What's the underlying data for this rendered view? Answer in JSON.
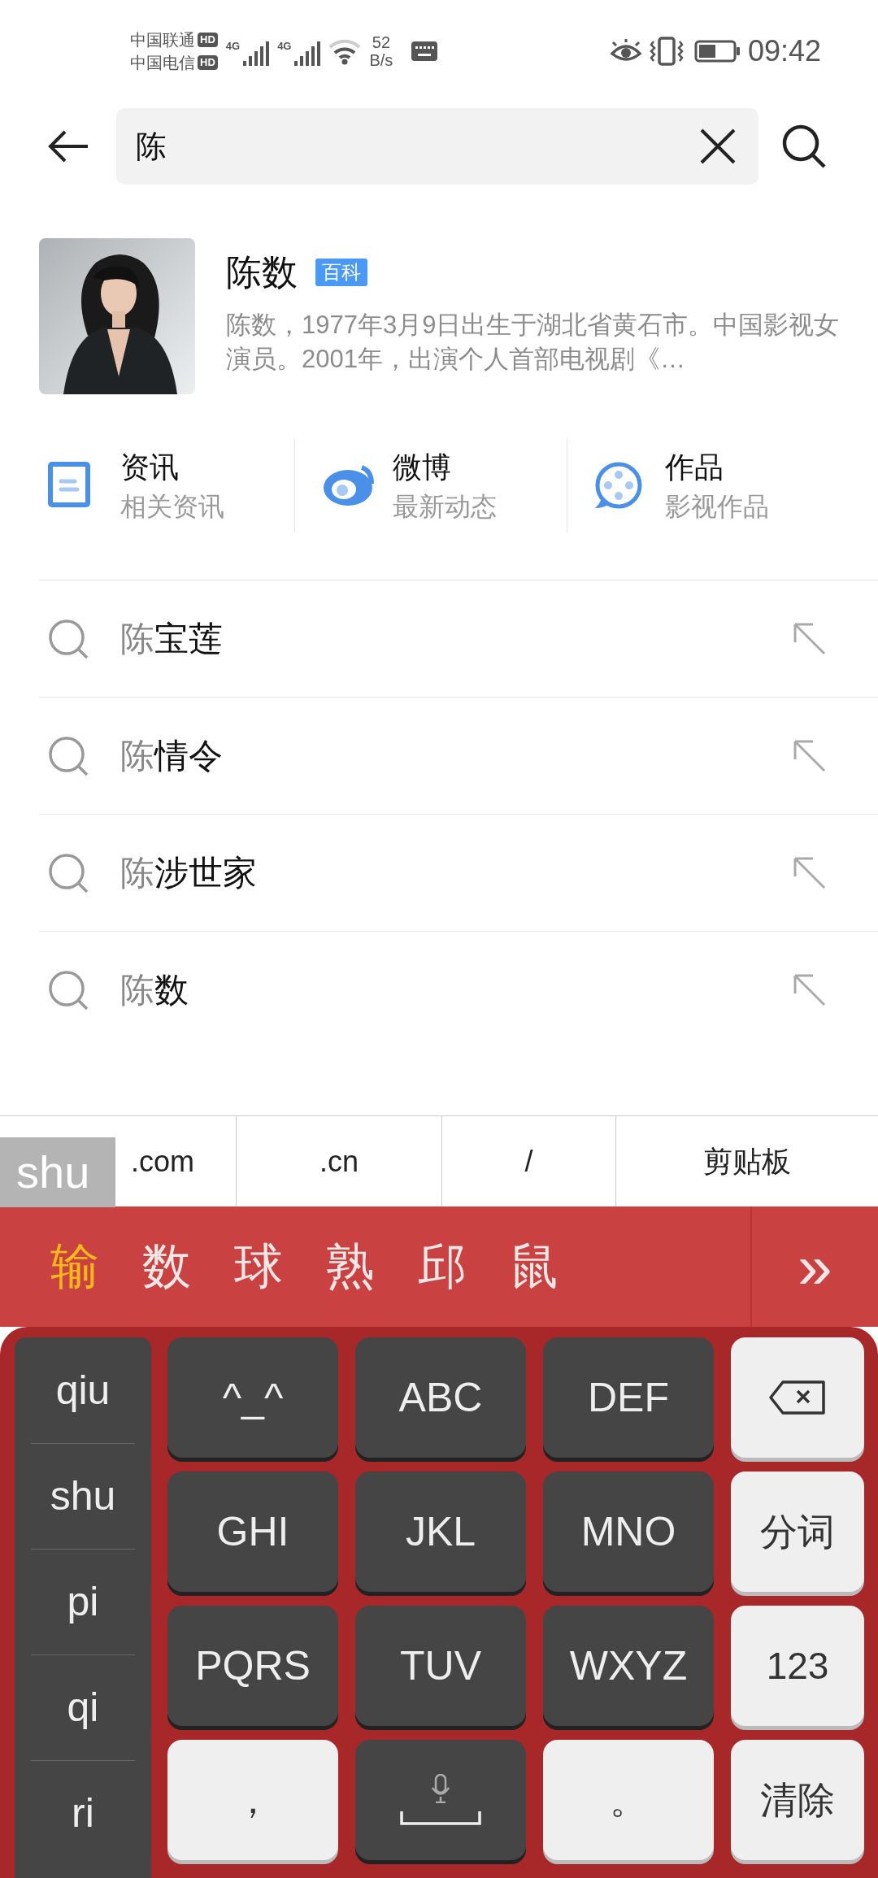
{
  "status_bar": {
    "carriers": [
      {
        "name": "中国联通",
        "badge": "HD"
      },
      {
        "name": "中国电信",
        "badge": "HD"
      }
    ],
    "network_types": [
      "4G",
      "4G"
    ],
    "speed_value": "52",
    "speed_unit": "B/s",
    "time": "09:42"
  },
  "search": {
    "value": "陈"
  },
  "result_card": {
    "title": "陈数",
    "badge": "百科",
    "description": "陈数，1977年3月9日出生于湖北省黄石市。中国影视女演员。2001年，出演个人首部电视剧《…"
  },
  "shortcuts": [
    {
      "kind": "news",
      "title": "资讯",
      "subtitle": "相关资讯"
    },
    {
      "kind": "weibo",
      "title": "微博",
      "subtitle": "最新动态"
    },
    {
      "kind": "works",
      "title": "作品",
      "subtitle": "影视作品"
    }
  ],
  "suggestions": [
    {
      "matched": "陈",
      "rest": "宝莲"
    },
    {
      "matched": "陈",
      "rest": "情令"
    },
    {
      "matched": "陈",
      "rest": "涉世家"
    },
    {
      "matched": "陈",
      "rest": "数"
    }
  ],
  "quick_bar": [
    ".com",
    ".cn",
    "/",
    "剪贴板"
  ],
  "composing": "shu",
  "candidates": [
    {
      "text": "输",
      "selected": true
    },
    {
      "text": "数",
      "selected": false
    },
    {
      "text": "球",
      "selected": false
    },
    {
      "text": "熟",
      "selected": false
    },
    {
      "text": "邱",
      "selected": false
    },
    {
      "text": "鼠",
      "selected": false
    }
  ],
  "more_candidates": "»",
  "pinyin_options": [
    "qiu",
    "shu",
    "pi",
    "qi",
    "ri"
  ],
  "keys": [
    {
      "kind": "letter",
      "label": "^_^"
    },
    {
      "kind": "letter",
      "label": "ABC"
    },
    {
      "kind": "letter",
      "label": "DEF"
    },
    {
      "kind": "backspace"
    },
    {
      "kind": "letter",
      "label": "GHI"
    },
    {
      "kind": "letter",
      "label": "JKL"
    },
    {
      "kind": "letter",
      "label": "MNO"
    },
    {
      "kind": "function",
      "label": "分词"
    },
    {
      "kind": "letter",
      "label": "PQRS"
    },
    {
      "kind": "letter",
      "label": "TUV"
    },
    {
      "kind": "letter",
      "label": "WXYZ"
    },
    {
      "kind": "function",
      "label": "123"
    },
    {
      "kind": "function",
      "label": "，"
    },
    {
      "kind": "space"
    },
    {
      "kind": "function",
      "label": "。"
    },
    {
      "kind": "function",
      "label": "清除"
    }
  ]
}
